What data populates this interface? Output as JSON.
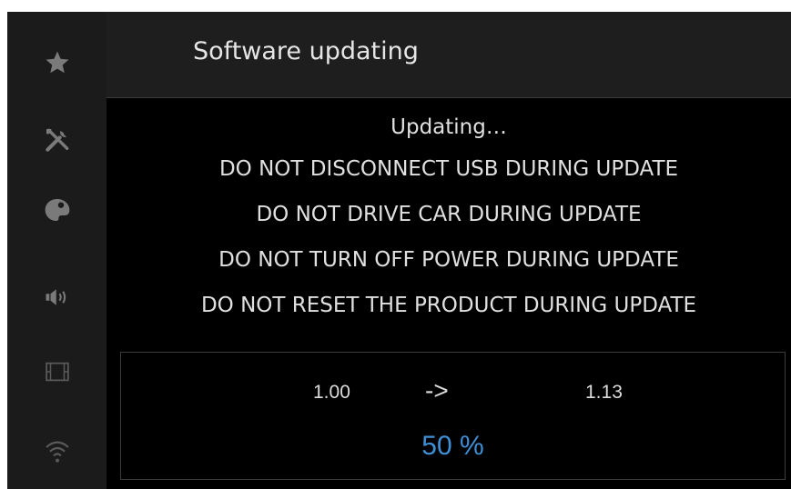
{
  "header": {
    "title": "Software updating"
  },
  "sidebar": {
    "icons": [
      "star-icon",
      "tools-icon",
      "palette-icon",
      "speaker-icon",
      "film-icon",
      "wifi-icon"
    ]
  },
  "messages": [
    "Updating…",
    "DO NOT DISCONNECT USB DURING UPDATE",
    "DO NOT DRIVE CAR DURING UPDATE",
    "DO NOT TURN OFF POWER DURING UPDATE",
    "DO NOT RESET THE PRODUCT DURING UPDATE"
  ],
  "update": {
    "current_version": "1.00",
    "arrow": "->",
    "target_version": "1.13",
    "progress_text": "50 %",
    "progress_percent": 50
  },
  "colors": {
    "background": "#000000",
    "sidebar": "#1b1b1b",
    "header": "#1e1e1e",
    "icon": "#7a7a7a",
    "accent": "#3f8fd6"
  }
}
